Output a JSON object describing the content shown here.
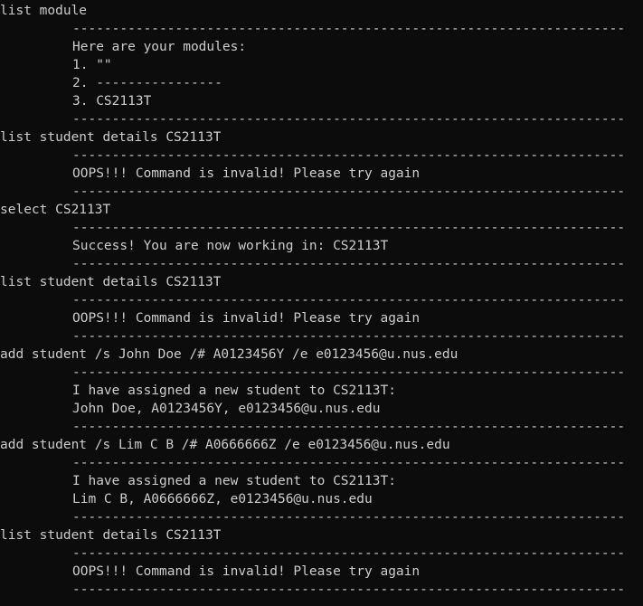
{
  "terminal": {
    "divider": "----------------------------------------------------------------------------------------------------",
    "blocks": [
      {
        "command": "list module",
        "output": [
          "Here are your modules:",
          "1. \"\"",
          "2. ----------------",
          "3. CS2113T"
        ]
      },
      {
        "command": "list student details CS2113T",
        "output": [
          "OOPS!!! Command is invalid! Please try again"
        ]
      },
      {
        "command": "select CS2113T",
        "output": [
          "Success! You are now working in: CS2113T"
        ]
      },
      {
        "command": "list student details CS2113T",
        "output": [
          "OOPS!!! Command is invalid! Please try again"
        ]
      },
      {
        "command": "add student /s John Doe /# A0123456Y /e e0123456@u.nus.edu",
        "output": [
          "I have assigned a new student to CS2113T:",
          "John Doe, A0123456Y, e0123456@u.nus.edu"
        ]
      },
      {
        "command": "add student /s Lim C B /# A0666666Z /e e0123456@u.nus.edu",
        "output": [
          "I have assigned a new student to CS2113T:",
          "Lim C B, A0666666Z, e0123456@u.nus.edu"
        ]
      },
      {
        "command": "list student details CS2113T",
        "output": [
          "OOPS!!! Command is invalid! Please try again"
        ]
      }
    ]
  }
}
